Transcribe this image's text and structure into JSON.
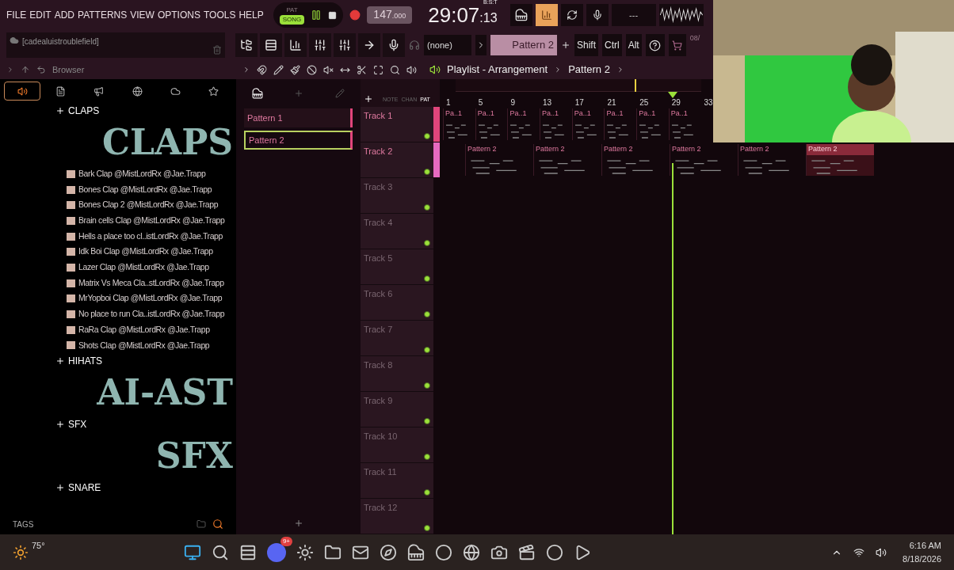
{
  "menu": [
    "FILE",
    "EDIT",
    "ADD",
    "PATTERNS",
    "VIEW",
    "OPTIONS",
    "TOOLS",
    "HELP"
  ],
  "transport": {
    "pat_label": "PAT",
    "song_label": "SONG",
    "song_selected": true,
    "tempo": "147",
    "tempo_decimals": ".000",
    "time": "29:07",
    "time_small": ":13",
    "time_unit": "B:S:T",
    "display": "---"
  },
  "hint_bar": {
    "text": "[cadealuistroublefield]"
  },
  "snap": "(none)",
  "pattern_selector": "Pattern 2",
  "modifier_keys": [
    "Shift",
    "Ctrl",
    "Alt"
  ],
  "news": "08/",
  "browser": {
    "title": "Browser",
    "tabs": [
      {
        "selected": true
      },
      {
        "selected": false
      },
      {
        "selected": false
      },
      {
        "selected": false
      },
      {
        "selected": false
      },
      {
        "selected": false
      }
    ],
    "folders": [
      {
        "name": "CLAPS",
        "banner": "CLAPS",
        "items": [
          "Bark Clap @MistLordRx @Jae.Trapp",
          "Bones Clap @MistLordRx @Jae.Trapp",
          "Bones Clap 2 @MistLordRx @Jae.Trapp",
          "Brain cells Clap @MistLordRx @Jae.Trapp",
          "Hells a place too cl..istLordRx @Jae.Trapp",
          "Idk Boi Clap  @MistLordRx @Jae.Trapp",
          "Lazer Clap  @MistLordRx @Jae.Trapp",
          "Matrix Vs Meca Cla..stLordRx @Jae.Trapp",
          "MrYopboi Clap @MistLordRx @Jae.Trapp",
          "No place to run Cla..istLordRx @Jae.Trapp",
          "RaRa Clap @MistLordRx @Jae.Trapp",
          "Shots Clap  @MistLordRx @Jae.Trapp"
        ]
      },
      {
        "name": "HIHATS",
        "banner": "AI-AST"
      },
      {
        "name": "SFX",
        "banner": "SFX"
      },
      {
        "name": "SNARE"
      }
    ],
    "footer": "TAGS"
  },
  "patterns": [
    {
      "name": "Pattern 1",
      "selected": false
    },
    {
      "name": "Pattern 2",
      "selected": true
    }
  ],
  "playlist": {
    "breadcrumb": [
      "Playlist - Arrangement",
      "Pattern 2"
    ],
    "view_tabs": [
      {
        "label": "NOTE",
        "selected": false
      },
      {
        "label": "CHAN",
        "selected": false
      },
      {
        "label": "PAT",
        "selected": true
      }
    ],
    "ruler": [
      "1",
      "5",
      "9",
      "13",
      "17",
      "21",
      "25",
      "29",
      "33"
    ],
    "tracks": [
      {
        "name": "Track 1",
        "color": "#e0457b",
        "clips": [
          {
            "label": "Pa..1",
            "selected": false
          },
          {
            "label": "Pa..1",
            "selected": false
          },
          {
            "label": "Pa..1",
            "selected": false
          },
          {
            "label": "Pa..1",
            "selected": false
          },
          {
            "label": "Pa..1",
            "selected": false
          },
          {
            "label": "Pa..1",
            "selected": false
          },
          {
            "label": "Pa..1",
            "selected": false
          },
          {
            "label": "Pa..1",
            "selected": false
          }
        ]
      },
      {
        "name": "Track 2",
        "color": "#e66ac0",
        "clips": [
          {
            "label": "Pattern 2",
            "selected": false
          },
          {
            "label": "Pattern 2",
            "selected": false
          },
          {
            "label": "Pattern 2",
            "selected": false
          },
          {
            "label": "Pattern 2",
            "selected": false
          },
          {
            "label": "Pattern 2",
            "selected": false
          },
          {
            "label": "Pattern 2",
            "selected": true
          }
        ]
      },
      {
        "name": "Track 3"
      },
      {
        "name": "Track 4"
      },
      {
        "name": "Track 5"
      },
      {
        "name": "Track 6"
      },
      {
        "name": "Track 7"
      },
      {
        "name": "Track 8"
      },
      {
        "name": "Track 9"
      },
      {
        "name": "Track 10"
      },
      {
        "name": "Track 11"
      },
      {
        "name": "Track 12"
      }
    ]
  },
  "taskbar": {
    "weather": "75°",
    "discord_badge": "9+",
    "time": "6:16 AM",
    "date": "8/18/2026"
  }
}
